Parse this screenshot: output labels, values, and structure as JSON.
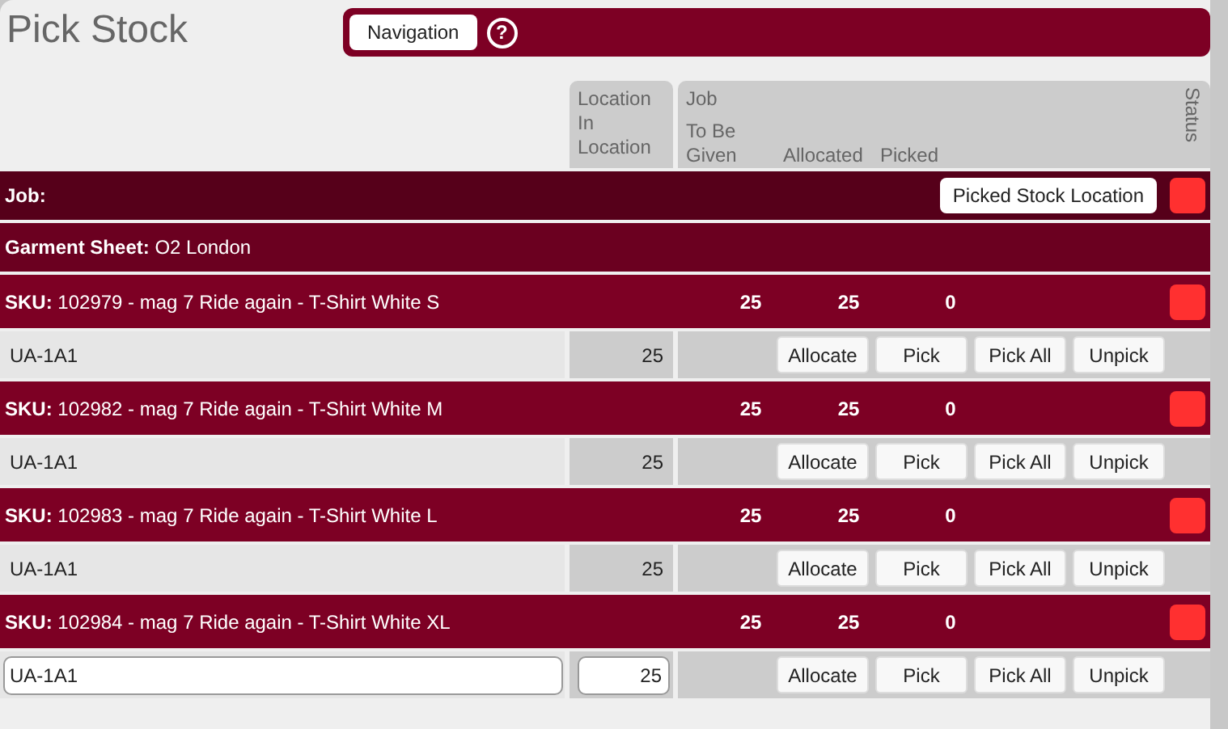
{
  "title": "Pick Stock",
  "toolbar": {
    "navigation": "Navigation",
    "help": "?"
  },
  "columns": {
    "location_group": "Location",
    "in_location": "In Location",
    "job_group": "Job",
    "to_be_given": "To Be Given",
    "allocated": "Allocated",
    "picked": "Picked",
    "status": "Status"
  },
  "job": {
    "label": "Job:",
    "button": "Picked Stock Location"
  },
  "garment_sheet": "**Garment Sheet:** O2 London",
  "skus": [
    {
      "title": "**SKU:** 102979 - mag 7 Ride again  - T-Shirt White S",
      "to_be_given": "25",
      "allocated": "25",
      "picked": "0",
      "location": {
        "name": "UA-1A1",
        "quantity": "25",
        "editing": false
      },
      "buttons": [
        "Allocate",
        "Pick",
        "Pick All",
        "Unpick"
      ]
    },
    {
      "title": "**SKU:** 102982 - mag 7 Ride again  - T-Shirt White M",
      "to_be_given": "25",
      "allocated": "25",
      "picked": "0",
      "location": {
        "name": "UA-1A1",
        "quantity": "25",
        "editing": false
      },
      "buttons": [
        "Allocate",
        "Pick",
        "Pick All",
        "Unpick"
      ]
    },
    {
      "title": "**SKU:** 102983 - mag 7 Ride again  - T-Shirt White L",
      "to_be_given": "25",
      "allocated": "25",
      "picked": "0",
      "location": {
        "name": "UA-1A1",
        "quantity": "25",
        "editing": false
      },
      "buttons": [
        "Allocate",
        "Pick",
        "Pick All",
        "Unpick"
      ]
    },
    {
      "title": "**SKU:** 102984 - mag 7 Ride again  - T-Shirt White XL",
      "to_be_given": "25",
      "allocated": "25",
      "picked": "0",
      "location": {
        "name": "UA-1A1",
        "quantity": "25",
        "editing": true
      },
      "buttons": [
        "Allocate",
        "Pick",
        "Pick All",
        "Unpick"
      ]
    }
  ]
}
